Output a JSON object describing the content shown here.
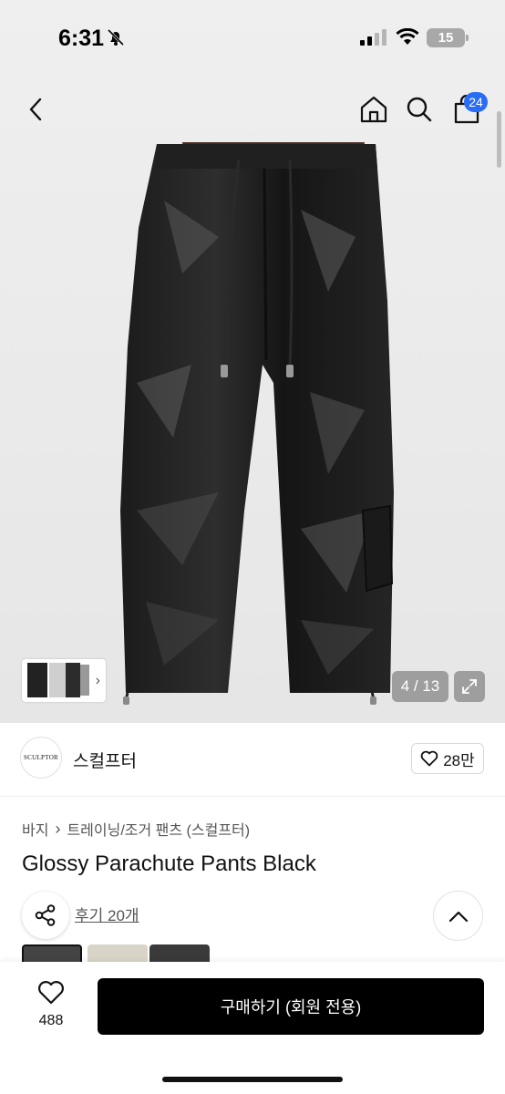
{
  "status_bar": {
    "time": "6:31",
    "battery": "15"
  },
  "header": {
    "cart_badge": "24"
  },
  "gallery": {
    "counter": "4 / 13"
  },
  "brand": {
    "logo_text": "SCULPTOR",
    "name": "스컬프터",
    "likes": "28만"
  },
  "breadcrumb": {
    "category": "바지",
    "subcategory": "트레이닝/조거 팬츠 (스컬프터)"
  },
  "product": {
    "title": "Glossy Parachute Pants Black",
    "reviews": "후기 20개"
  },
  "bottom_bar": {
    "wish_count": "488",
    "buy_label": "구매하기 (회원 전용)"
  },
  "icons": {
    "back": "chevron-left-icon",
    "home": "home-icon",
    "search": "search-icon",
    "cart": "cart-icon",
    "share": "share-icon",
    "heart": "heart-icon",
    "expand": "expand-icon",
    "scroll_top": "chevron-up-icon"
  },
  "colors": {
    "accent_badge": "#2a6df5",
    "buy_button": "#000000"
  }
}
